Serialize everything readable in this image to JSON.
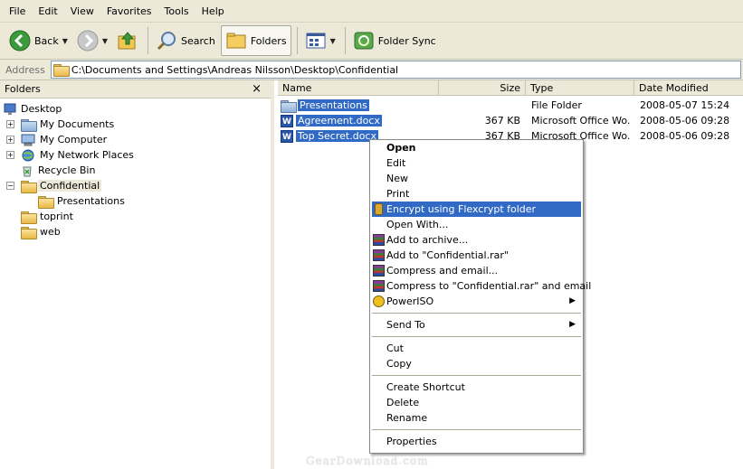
{
  "menubar": {
    "items": [
      "File",
      "Edit",
      "View",
      "Favorites",
      "Tools",
      "Help"
    ]
  },
  "toolbar": {
    "back_label": "Back",
    "search_label": "Search",
    "folders_label": "Folders",
    "foldersync_label": "Folder Sync"
  },
  "address": {
    "label": "Address",
    "value": "C:\\Documents and Settings\\Andreas Nilsson\\Desktop\\Confidential"
  },
  "folders_pane": {
    "title": "Folders",
    "close": "×",
    "items": [
      {
        "label": "Desktop",
        "icon": "desktop-icon"
      },
      {
        "label": "My Documents",
        "icon": "my-documents-icon"
      },
      {
        "label": "My Computer",
        "icon": "my-computer-icon"
      },
      {
        "label": "My Network Places",
        "icon": "network-places-icon"
      },
      {
        "label": "Recycle Bin",
        "icon": "recycle-bin-icon"
      },
      {
        "label": "Confidential",
        "icon": "folder-icon"
      },
      {
        "label": "Presentations",
        "icon": "folder-icon"
      },
      {
        "label": "toprint",
        "icon": "folder-icon"
      },
      {
        "label": "web",
        "icon": "folder-icon"
      }
    ]
  },
  "filelist": {
    "columns": [
      "Name",
      "Size",
      "Type",
      "Date Modified"
    ],
    "rows": [
      {
        "name": "Presentations",
        "size": "",
        "type": "File Folder",
        "date": "2008-05-07 15:24",
        "icon": "folder-icon"
      },
      {
        "name": "Agreement.docx",
        "size": "367 KB",
        "type": "Microsoft Office Wo...",
        "date": "2008-05-06 09:28",
        "icon": "word-doc-icon"
      },
      {
        "name": "Top Secret.docx",
        "size": "367 KB",
        "type": "Microsoft Office Wo...",
        "date": "2008-05-06 09:28",
        "icon": "word-doc-icon"
      }
    ]
  },
  "context_menu": {
    "items": [
      {
        "label": "Open"
      },
      {
        "label": "Edit"
      },
      {
        "label": "New"
      },
      {
        "label": "Print"
      },
      {
        "label": "Encrypt using Flexcrypt folder"
      },
      {
        "label": "Open With..."
      },
      {
        "label": "Add to archive..."
      },
      {
        "label": "Add to \"Confidential.rar\""
      },
      {
        "label": "Compress and email..."
      },
      {
        "label": "Compress to \"Confidential.rar\" and email"
      },
      {
        "label": "PowerISO"
      },
      {
        "label": "Send To"
      },
      {
        "label": "Cut"
      },
      {
        "label": "Copy"
      },
      {
        "label": "Create Shortcut"
      },
      {
        "label": "Delete"
      },
      {
        "label": "Rename"
      },
      {
        "label": "Properties"
      }
    ]
  },
  "colors": {
    "selection": "#316ac5",
    "chrome": "#ece9d8"
  },
  "watermark": "GearDownload.com"
}
